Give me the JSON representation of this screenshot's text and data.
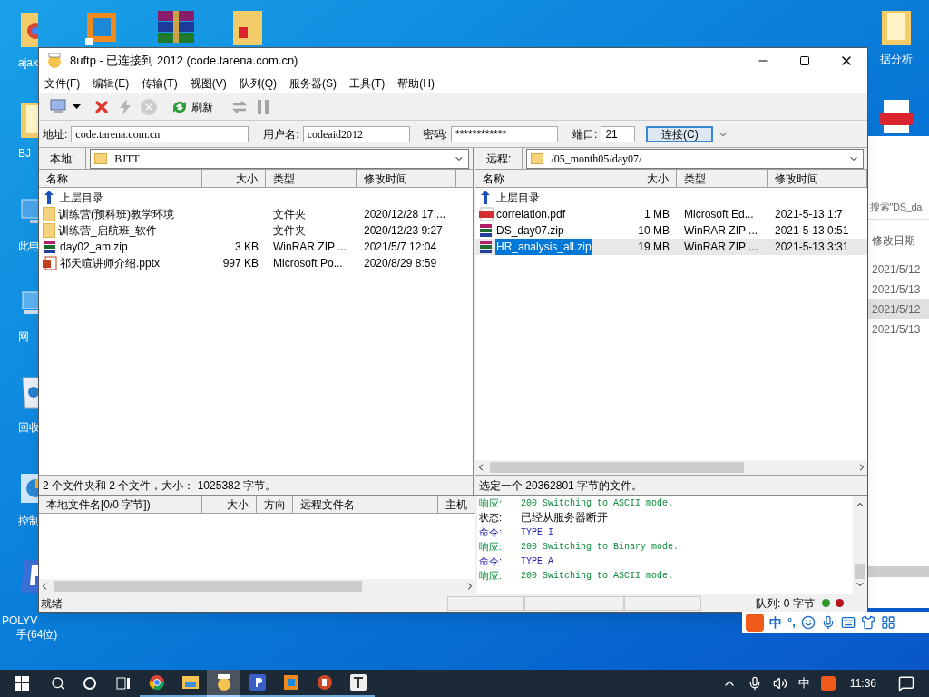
{
  "desktop": {
    "left_icons": [
      {
        "kind": "chrome-folder",
        "label": "ajax"
      },
      {
        "kind": "folder",
        "label": "BJ"
      },
      {
        "kind": "pc",
        "label": "此电"
      },
      {
        "kind": "network",
        "label": "网"
      },
      {
        "kind": "bin",
        "label": "回收"
      },
      {
        "kind": "control",
        "label": "控制"
      },
      {
        "kind": "polyv",
        "label": "POLYV",
        "label_2": "手(64位)"
      }
    ],
    "right_icons": [
      {
        "kind": "folder",
        "label": "据分析"
      },
      {
        "kind": "pdf"
      }
    ],
    "top_icons": [
      {
        "kind": "orange"
      },
      {
        "kind": "winrar"
      },
      {
        "kind": "pdf-folder"
      }
    ]
  },
  "background_window": {
    "search": "搜索\"DS_da",
    "column": "修改日期",
    "dates": [
      "2021/5/12",
      "2021/5/13",
      "2021/5/12",
      "2021/5/13"
    ]
  },
  "window": {
    "title": "8uftp - 已连接到 2012 (code.tarena.com.cn)",
    "menu": [
      "文件(F)",
      "编辑(E)",
      "传输(T)",
      "视图(V)",
      "队列(Q)",
      "服务器(S)",
      "工具(T)",
      "帮助(H)"
    ],
    "toolbar": [
      {
        "kind": "computer",
        "disabled": false
      },
      {
        "kind": "dropdown",
        "disabled": false
      },
      {
        "kind": "disconnect",
        "disabled": false
      },
      {
        "kind": "lightning",
        "disabled": true
      },
      {
        "kind": "stop",
        "disabled": true
      },
      {
        "kind": "refresh",
        "label": "刷新",
        "disabled": false
      },
      {
        "kind": "transfer",
        "disabled": true
      },
      {
        "kind": "pause",
        "disabled": true
      }
    ],
    "connection": {
      "address_label": "地址:",
      "address": "code.tarena.com.cn",
      "user_label": "用户名:",
      "user": "codeaid2012",
      "password_label": "密码:",
      "password": "************",
      "port_label": "端口:",
      "port": "21",
      "connect": "连接(C)"
    },
    "local": {
      "label": "本地:",
      "path": "BJTT",
      "columns": [
        "名称",
        "大小",
        "类型",
        "修改时间"
      ],
      "rows": [
        {
          "kind": "up",
          "name": "上层目录",
          "selected": false
        },
        {
          "kind": "folder",
          "name": "训练营(预科班)教学环境",
          "type": "文件夹",
          "modified": "2020/12/28 17:...",
          "selected": false
        },
        {
          "kind": "folder",
          "name": "训练营_启航班_软件",
          "type": "文件夹",
          "modified": "2020/12/23 9:27",
          "selected": false
        },
        {
          "kind": "zip",
          "name": "day02_am.zip",
          "size": "3 KB",
          "type": "WinRAR ZIP ...",
          "modified": "2021/5/7 12:04",
          "selected": false
        },
        {
          "kind": "pptx",
          "name": "祁天暄讲师介绍.pptx",
          "size": "997 KB",
          "type": "Microsoft Po...",
          "modified": "2020/8/29 8:59",
          "selected": false
        }
      ],
      "status": "2 个文件夹和 2 个文件，大小： 1025382 字节。"
    },
    "remote": {
      "label": "远程:",
      "path": "/05_month05/day07/",
      "columns": [
        "名称",
        "大小",
        "类型",
        "修改时间"
      ],
      "rows": [
        {
          "kind": "up",
          "name": "上层目录",
          "selected": false
        },
        {
          "kind": "pdf",
          "name": "correlation.pdf",
          "size": "1 MB",
          "type": "Microsoft Ed...",
          "modified": "2021-5-13 1:7",
          "selected": false
        },
        {
          "kind": "zip",
          "name": "DS_day07.zip",
          "size": "10 MB",
          "type": "WinRAR ZIP ...",
          "modified": "2021-5-13 0:51",
          "selected": false
        },
        {
          "kind": "zip",
          "name": "HR_analysis_all.zip",
          "size": "19 MB",
          "type": "WinRAR ZIP ...",
          "modified": "2021-5-13 3:31",
          "selected": true
        }
      ],
      "status": "选定一个 20362801 字节的文件。"
    },
    "queue": {
      "columns": [
        "本地文件名[0/0 字节])",
        "大小",
        "方向",
        "远程文件名",
        "主机"
      ]
    },
    "log": [
      {
        "kind": "response",
        "label": "响应:",
        "text": "200 Switching to ASCII mode."
      },
      {
        "kind": "status",
        "label": "状态:",
        "text": "已经从服务器断开"
      },
      {
        "kind": "command",
        "label": "命令:",
        "text": "TYPE I"
      },
      {
        "kind": "response",
        "label": "响应:",
        "text": "200 Switching to Binary mode."
      },
      {
        "kind": "command",
        "label": "命令:",
        "text": "TYPE A"
      },
      {
        "kind": "response",
        "label": "响应:",
        "text": "200 Switching to ASCII mode."
      }
    ],
    "status_bar": {
      "text": "就绪",
      "queue": "队列: 0 字节"
    }
  },
  "ime_bar": {
    "mode": "中",
    "punct": "°,"
  },
  "taskbar": {
    "apps": [
      {
        "kind": "chrome",
        "selected": false
      },
      {
        "kind": "explorer",
        "selected": false
      },
      {
        "kind": "ftp",
        "selected": true
      },
      {
        "kind": "polyv",
        "selected": false
      },
      {
        "kind": "orange",
        "selected": false
      },
      {
        "kind": "powerpoint",
        "selected": false
      },
      {
        "kind": "typora",
        "selected": false
      }
    ],
    "ime": "中",
    "time": "11:36"
  }
}
